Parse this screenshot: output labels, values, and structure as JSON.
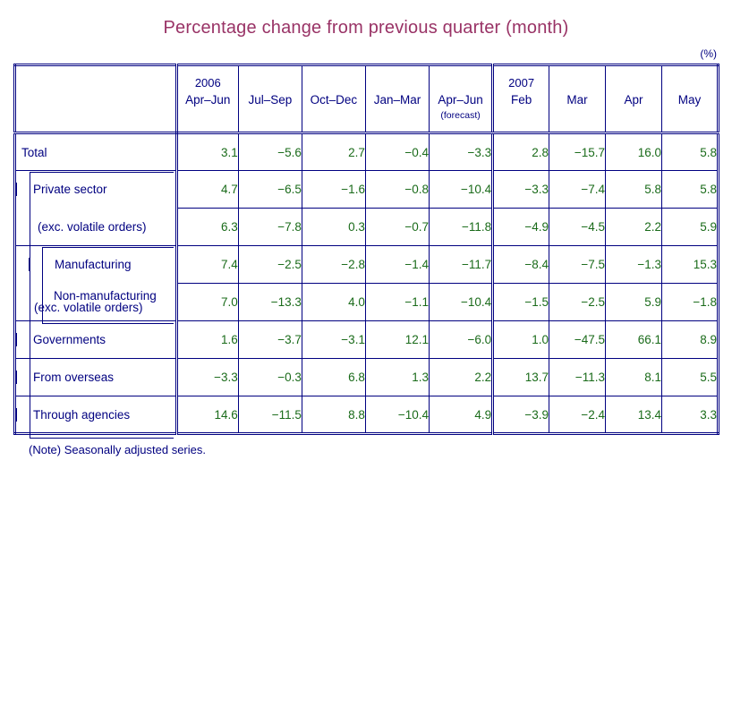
{
  "title": "Percentage change from previous quarter (month)",
  "unit_label": "(%)",
  "footnote": "(Note) Seasonally adjusted series.",
  "colors": {
    "title": "#993366",
    "border": "#000080",
    "label_text": "#000080",
    "value_text": "#1a6b1a"
  },
  "header": {
    "corner": "",
    "columns": [
      {
        "year": "2006",
        "period": "Apr–Jun",
        "sub": "",
        "year_start": false
      },
      {
        "year": "",
        "period": "Jul–Sep",
        "sub": "",
        "year_start": false
      },
      {
        "year": "",
        "period": "Oct–Dec",
        "sub": "",
        "year_start": false
      },
      {
        "year": "",
        "period": "Jan–Mar",
        "sub": "",
        "year_start": false
      },
      {
        "year": "",
        "period": "Apr–Jun",
        "sub": "(forecast)",
        "year_start": false
      },
      {
        "year": "2007",
        "period": "Feb",
        "sub": "",
        "year_start": true
      },
      {
        "year": "",
        "period": "Mar",
        "sub": "",
        "year_start": false
      },
      {
        "year": "",
        "period": "Apr",
        "sub": "",
        "year_start": false
      },
      {
        "year": "",
        "period": "May",
        "sub": "",
        "year_start": false
      }
    ]
  },
  "rows": [
    {
      "label": "Total",
      "label2": "",
      "indent": 0,
      "values": [
        "3.1",
        "−5.6",
        "2.7",
        "−0.4",
        "−3.3",
        "2.8",
        "−15.7",
        "16.0",
        "5.8"
      ]
    },
    {
      "label": "Private sector",
      "label2": "",
      "indent": 1,
      "values": [
        "4.7",
        "−6.5",
        "−1.6",
        "−0.8",
        "−10.4",
        "−3.3",
        "−7.4",
        "5.8",
        "5.8"
      ]
    },
    {
      "label": "(exc. volatile orders)",
      "label2": "",
      "indent": 2,
      "values": [
        "6.3",
        "−7.8",
        "0.3",
        "−0.7",
        "−11.8",
        "−4.9",
        "−4.5",
        "2.2",
        "5.9"
      ]
    },
    {
      "label": "Manufacturing",
      "label2": "",
      "indent": 3,
      "values": [
        "7.4",
        "−2.5",
        "−2.8",
        "−1.4",
        "−11.7",
        "−8.4",
        "−7.5",
        "−1.3",
        "15.3"
      ]
    },
    {
      "label": "Non-manufacturing",
      "label2": "(exc. volatile orders)",
      "indent": 3,
      "values": [
        "7.0",
        "−13.3",
        "4.0",
        "−1.1",
        "−10.4",
        "−1.5",
        "−2.5",
        "5.9",
        "−1.8"
      ]
    },
    {
      "label": "Governments",
      "label2": "",
      "indent": 1,
      "values": [
        "1.6",
        "−3.7",
        "−3.1",
        "12.1",
        "−6.0",
        "1.0",
        "−47.5",
        "66.1",
        "8.9"
      ]
    },
    {
      "label": "From overseas",
      "label2": "",
      "indent": 1,
      "values": [
        "−3.3",
        "−0.3",
        "6.8",
        "1.3",
        "2.2",
        "13.7",
        "−11.3",
        "8.1",
        "5.5"
      ]
    },
    {
      "label": "Through agencies",
      "label2": "",
      "indent": 1,
      "values": [
        "14.6",
        "−11.5",
        "8.8",
        "−10.4",
        "4.9",
        "−3.9",
        "−2.4",
        "13.4",
        "3.3"
      ]
    }
  ],
  "chart_data": {
    "type": "table",
    "title": "Percentage change from previous quarter (month)",
    "ylabel": "(%)",
    "categories": [
      "2006 Apr–Jun",
      "Jul–Sep",
      "Oct–Dec",
      "Jan–Mar",
      "Apr–Jun (forecast)",
      "2007 Feb",
      "Mar",
      "Apr",
      "May"
    ],
    "series": [
      {
        "name": "Total",
        "values": [
          3.1,
          -5.6,
          2.7,
          -0.4,
          -3.3,
          2.8,
          -15.7,
          16.0,
          5.8
        ]
      },
      {
        "name": "Private sector",
        "values": [
          4.7,
          -6.5,
          -1.6,
          -0.8,
          -10.4,
          -3.3,
          -7.4,
          5.8,
          5.8
        ]
      },
      {
        "name": "Private sector (exc. volatile orders)",
        "values": [
          6.3,
          -7.8,
          0.3,
          -0.7,
          -11.8,
          -4.9,
          -4.5,
          2.2,
          5.9
        ]
      },
      {
        "name": "Manufacturing",
        "values": [
          7.4,
          -2.5,
          -2.8,
          -1.4,
          -11.7,
          -8.4,
          -7.5,
          -1.3,
          15.3
        ]
      },
      {
        "name": "Non-manufacturing (exc. volatile orders)",
        "values": [
          7.0,
          -13.3,
          4.0,
          -1.1,
          -10.4,
          -1.5,
          -2.5,
          5.9,
          -1.8
        ]
      },
      {
        "name": "Governments",
        "values": [
          1.6,
          -3.7,
          -3.1,
          12.1,
          -6.0,
          1.0,
          -47.5,
          66.1,
          8.9
        ]
      },
      {
        "name": "From overseas",
        "values": [
          -3.3,
          -0.3,
          6.8,
          1.3,
          2.2,
          13.7,
          -11.3,
          8.1,
          5.5
        ]
      },
      {
        "name": "Through agencies",
        "values": [
          14.6,
          -11.5,
          8.8,
          -10.4,
          4.9,
          -3.9,
          -2.4,
          13.4,
          3.3
        ]
      }
    ],
    "note": "(Note) Seasonally adjusted series."
  }
}
